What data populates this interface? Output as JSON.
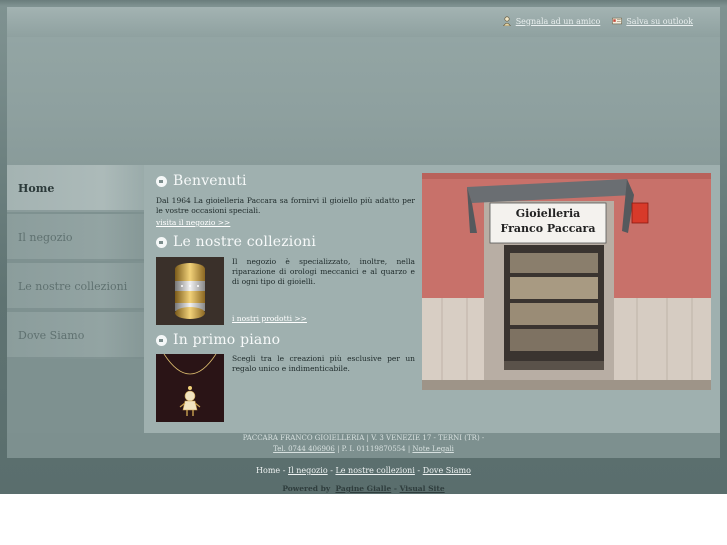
{
  "top_links": {
    "friend": "Segnala ad un amico",
    "outlook": "Salva su outlook"
  },
  "nav": {
    "items": [
      {
        "label": "Home"
      },
      {
        "label": "Il negozio"
      },
      {
        "label": "Le nostre collezioni"
      },
      {
        "label": "Dove Siamo"
      }
    ]
  },
  "welcome": {
    "title": "Benvenuti",
    "text": "Dal 1964 La gioielleria Paccara sa fornirvi il gioiello più adatto per le vostre occasioni speciali.",
    "link": "visita il negozio >>"
  },
  "collections": {
    "title": "Le nostre collezioni",
    "text": "Il negozio è specializzato, inoltre, nella riparazione di orologi meccanici e al quarzo e di ogni tipo di gioielli.",
    "link": "i nostri prodotti >>"
  },
  "featured": {
    "title": "In primo piano",
    "text": "Scegli tra le creazioni più esclusive per un regalo unico e indimenticabile."
  },
  "shop_sign": {
    "line1": "Gioielleria",
    "line2": "Franco Paccara"
  },
  "footer": {
    "company": "PACCARA FRANCO GIOIELLERIA | V. 3 VENEZIE 17 - TERNI (TR) -",
    "phone": "Tel. 0744 406906",
    "vat": "| P. I. 01119870554 |",
    "legal": "Note Legali"
  },
  "bottom_nav": {
    "home": "Home",
    "sep": " - ",
    "negozio": "Il negozio",
    "collezioni": "Le nostre collezioni",
    "dove": "Dove Siamo"
  },
  "powered": {
    "label": "Powered by",
    "pagine": "Pagine Gialle",
    "dash": " - ",
    "visual": "Visual Site"
  },
  "colors": {
    "background": "#6d8180",
    "content": "#9fb0af",
    "nav_active": "#a4b3b2",
    "shop_wall": "#c56f66"
  }
}
